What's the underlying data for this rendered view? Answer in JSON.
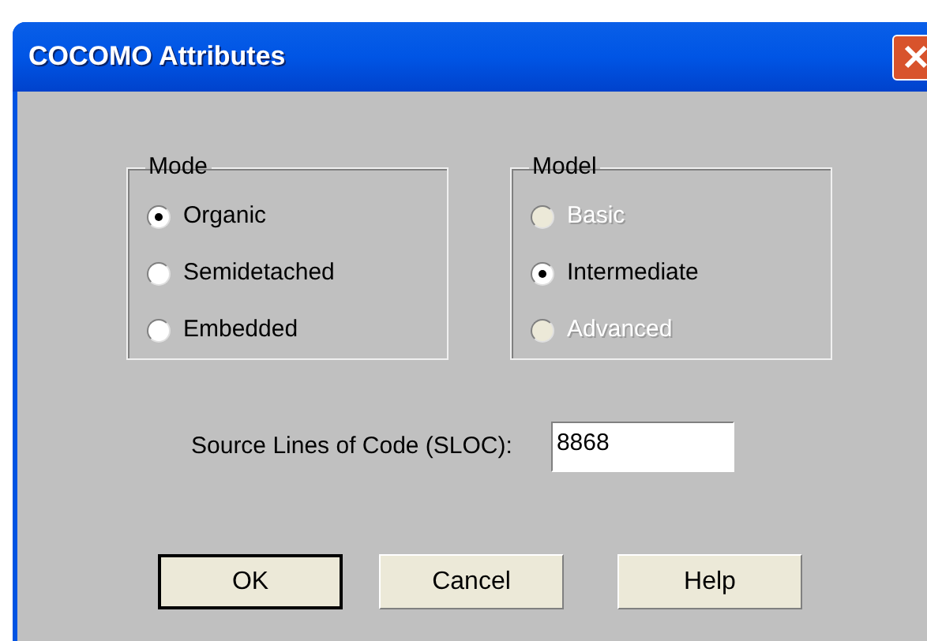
{
  "window": {
    "title": "COCOMO Attributes"
  },
  "groups": [
    {
      "title": "Mode",
      "options": [
        {
          "label": "Organic",
          "selected": true,
          "disabled": false
        },
        {
          "label": "Semidetached",
          "selected": false,
          "disabled": false
        },
        {
          "label": "Embedded",
          "selected": false,
          "disabled": false
        }
      ]
    },
    {
      "title": "Model",
      "options": [
        {
          "label": "Basic",
          "selected": false,
          "disabled": true
        },
        {
          "label": "Intermediate",
          "selected": true,
          "disabled": false
        },
        {
          "label": "Advanced",
          "selected": false,
          "disabled": true
        }
      ]
    }
  ],
  "sloc": {
    "label": "Source Lines of Code (SLOC):",
    "value": "8868"
  },
  "buttons": [
    {
      "label": "OK",
      "default": true
    },
    {
      "label": "Cancel",
      "default": false
    },
    {
      "label": "Help",
      "default": false
    }
  ]
}
